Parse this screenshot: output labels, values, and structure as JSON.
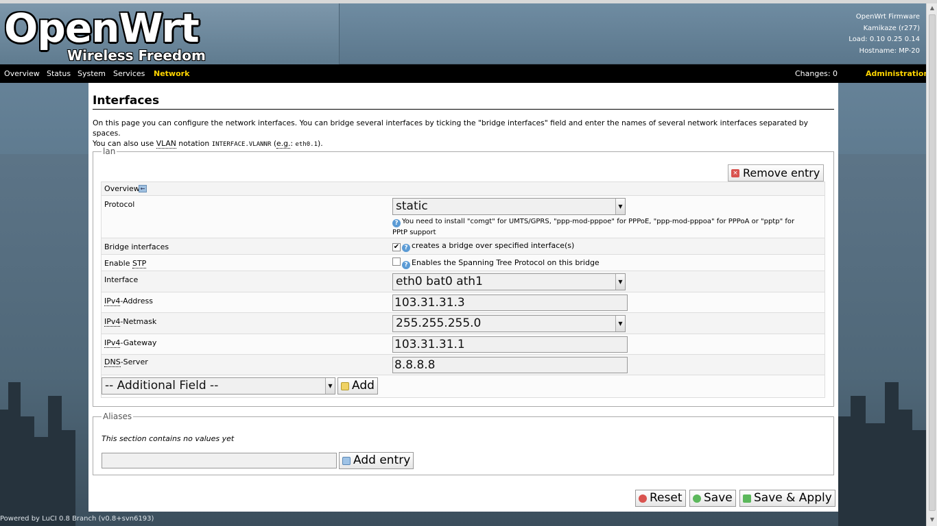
{
  "header": {
    "logo_main": "OpenWrt",
    "logo_sub": "Wireless Freedom",
    "firmware": "OpenWrt Firmware",
    "version": "Kamikaze (r277)",
    "load": "Load: 0.10 0.25 0.14",
    "hostname": "Hostname: MP-20"
  },
  "menu": {
    "items": [
      "Overview",
      "Status",
      "System",
      "Services",
      "Network"
    ],
    "changes": "Changes: 0",
    "admin": "Administration"
  },
  "page": {
    "title": "Interfaces",
    "desc_1": "On this page you can configure the network interfaces. You can bridge several interfaces by ticking the \"bridge interfaces\" field and enter the names of several network interfaces separated by spaces.",
    "desc_2a": "You can also use ",
    "desc_vlan": "VLAN",
    "desc_2b": " notation ",
    "desc_code1": "INTERFACE.VLANNR",
    "desc_2c": " (",
    "desc_eg": "e.g.",
    "desc_2d": ": ",
    "desc_code2": "eth0.1",
    "desc_2e": ")."
  },
  "lan": {
    "legend": "lan",
    "remove": "Remove entry",
    "overview": "Overview",
    "protocol_label": "Protocol",
    "protocol_value": "static",
    "protocol_hint": "You need to install \"comgt\" for UMTS/GPRS, \"ppp-mod-pppoe\" for PPPoE, \"ppp-mod-pppoa\" for PPPoA or \"pptp\" for PPtP support",
    "bridge_label": "Bridge interfaces",
    "bridge_hint": "creates a bridge over specified interface(s)",
    "bridge_checked": true,
    "stp_label_a": "Enable ",
    "stp_label_b": "STP",
    "stp_hint": "Enables the Spanning Tree Protocol on this bridge",
    "stp_checked": false,
    "interface_label": "Interface",
    "interface_value": "eth0 bat0 ath1",
    "ipv4_addr_label_a": "IPv4",
    "ipv4_addr_label_b": "-Address",
    "ipv4_addr_value": "103.31.31.3",
    "ipv4_mask_label_a": "IPv4",
    "ipv4_mask_label_b": "-Netmask",
    "ipv4_mask_value": "255.255.255.0",
    "ipv4_gw_label_a": "IPv4",
    "ipv4_gw_label_b": "-Gateway",
    "ipv4_gw_value": "103.31.31.1",
    "dns_label_a": "DNS",
    "dns_label_b": "-Server",
    "dns_value": "8.8.8.8",
    "additional_field": "-- Additional Field --",
    "add": "Add"
  },
  "aliases": {
    "legend": "Aliases",
    "empty": "This section contains no values yet",
    "add_entry": "Add entry",
    "input_value": ""
  },
  "buttons": {
    "reset": "Reset",
    "save": "Save",
    "save_apply": "Save & Apply"
  },
  "footer": {
    "powered": "Powered by LuCI 0.8 Branch (v0.8+svn6193)"
  },
  "colors": {
    "menu_bg": "#000000",
    "menu_active": "#ffd500"
  }
}
